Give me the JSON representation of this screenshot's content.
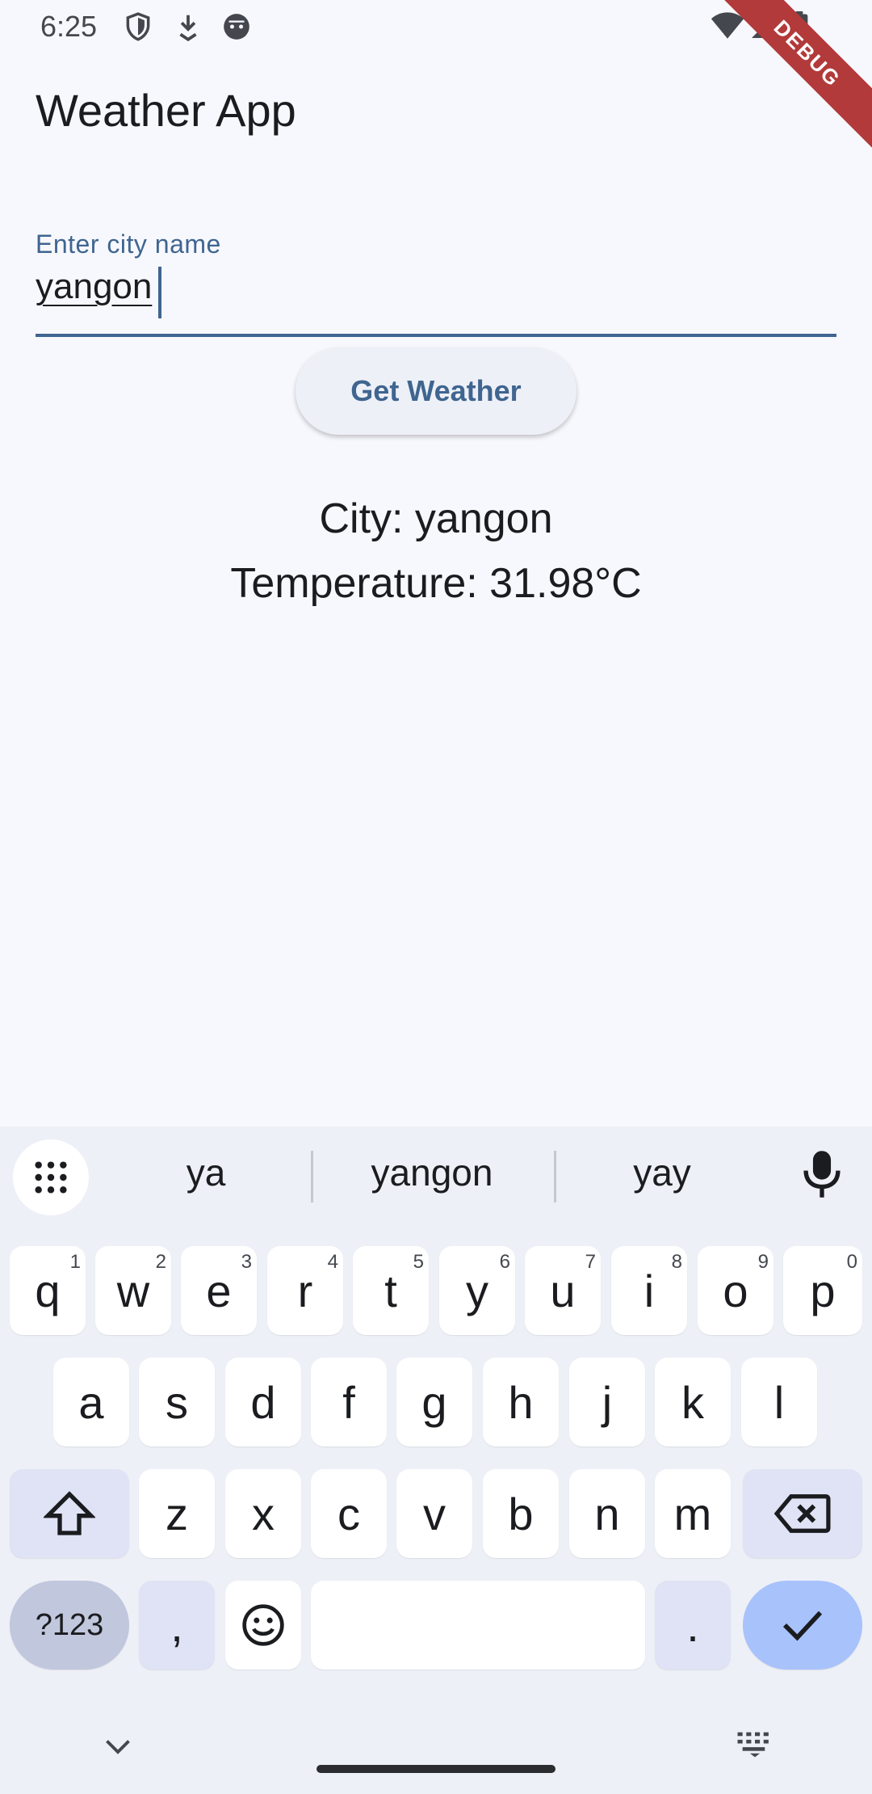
{
  "status_bar": {
    "time": "6:25",
    "left_icons": [
      "shield-icon",
      "download-icon",
      "android-face-icon"
    ],
    "right_icons": [
      "wifi-icon",
      "signal-icon",
      "battery-icon"
    ]
  },
  "debug_banner": "DEBUG",
  "app": {
    "title": "Weather App",
    "city_input": {
      "label": "Enter city name",
      "value": "yangon"
    },
    "get_weather_label": "Get Weather",
    "result": {
      "city_line": "City: yangon",
      "temperature_line": "Temperature: 31.98°C"
    }
  },
  "colors": {
    "accent": "#3f6590",
    "background": "#f7f8fd",
    "keyboard_bg": "#eef0f7",
    "enter_key": "#a8c2fc",
    "debug_ribbon": "#b23a3a"
  },
  "keyboard": {
    "suggestions": [
      "ya",
      "yangon",
      "yay"
    ],
    "row1": [
      {
        "k": "q",
        "h": "1"
      },
      {
        "k": "w",
        "h": "2"
      },
      {
        "k": "e",
        "h": "3"
      },
      {
        "k": "r",
        "h": "4"
      },
      {
        "k": "t",
        "h": "5"
      },
      {
        "k": "y",
        "h": "6"
      },
      {
        "k": "u",
        "h": "7"
      },
      {
        "k": "i",
        "h": "8"
      },
      {
        "k": "o",
        "h": "9"
      },
      {
        "k": "p",
        "h": "0"
      }
    ],
    "row2": [
      "a",
      "s",
      "d",
      "f",
      "g",
      "h",
      "j",
      "k",
      "l"
    ],
    "row3": [
      "z",
      "x",
      "c",
      "v",
      "b",
      "n",
      "m"
    ],
    "symbols_label": "?123",
    "comma_label": ",",
    "period_label": ".",
    "icons": [
      "keyboard-grid-icon",
      "mic-icon",
      "shift-icon",
      "backspace-icon",
      "emoji-icon",
      "check-icon",
      "chevron-down-icon",
      "keyboard-icon"
    ]
  }
}
